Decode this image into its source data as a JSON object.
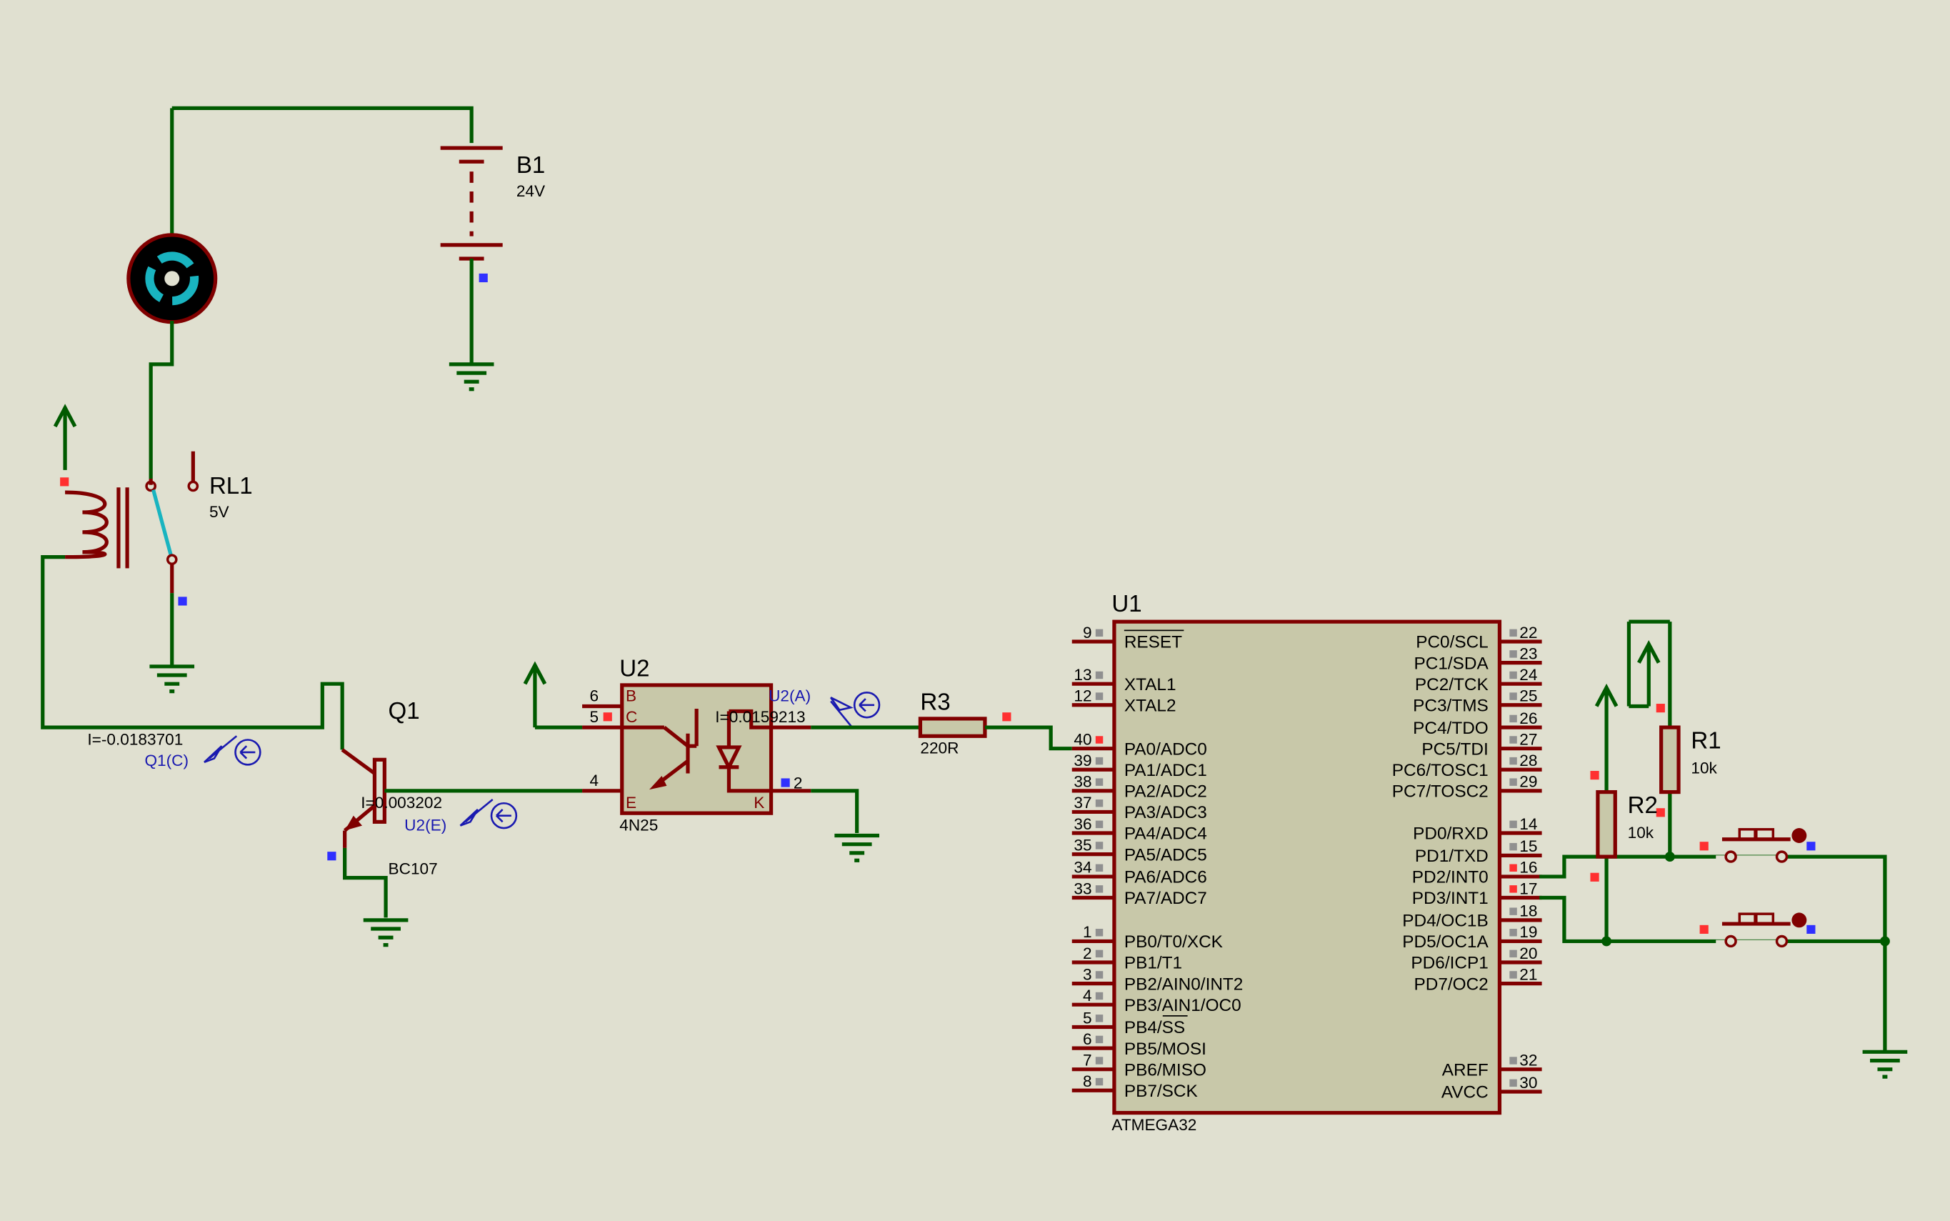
{
  "colors": {
    "background": "#e0e0d0",
    "wire": "#005a00",
    "component": "#800000",
    "chip_fill": "#c8c8a9",
    "probe": "#1a1ab0",
    "pin_red": "#ff3030",
    "pin_blue": "#3030ff",
    "pin_grey": "#909090",
    "motor_accent": "#19b4c0"
  },
  "battery": {
    "ref": "B1",
    "value": "24V"
  },
  "relay": {
    "ref": "RL1",
    "value": "5V"
  },
  "transistor": {
    "ref": "Q1",
    "part": "BC107"
  },
  "optocoupler": {
    "ref": "U2",
    "part": "4N25",
    "pins": {
      "b_num": "6",
      "b_name": "B",
      "c_num": "5",
      "c_name": "C",
      "e_num": "4",
      "e_name": "E",
      "k_num": "2",
      "k_name": "K"
    }
  },
  "resistors": {
    "r3": {
      "ref": "R3",
      "value": "220R"
    },
    "r1": {
      "ref": "R1",
      "value": "10k"
    },
    "r2": {
      "ref": "R2",
      "value": "10k"
    }
  },
  "probes": {
    "q1c": {
      "reading": "I=-0.0183701",
      "name": "Q1(C)"
    },
    "u2e": {
      "reading": "I=0.003202",
      "name": "U2(E)"
    },
    "u2a": {
      "reading": "I=0.0159213",
      "name": "U2(A)"
    }
  },
  "mcu": {
    "ref": "U1",
    "part": "ATMEGA32",
    "left_pins": [
      {
        "num": "9",
        "name": "RESET"
      },
      {
        "num": "13",
        "name": "XTAL1"
      },
      {
        "num": "12",
        "name": "XTAL2"
      },
      {
        "num": "40",
        "name": "PA0/ADC0"
      },
      {
        "num": "39",
        "name": "PA1/ADC1"
      },
      {
        "num": "38",
        "name": "PA2/ADC2"
      },
      {
        "num": "37",
        "name": "PA3/ADC3"
      },
      {
        "num": "36",
        "name": "PA4/ADC4"
      },
      {
        "num": "35",
        "name": "PA5/ADC5"
      },
      {
        "num": "34",
        "name": "PA6/ADC6"
      },
      {
        "num": "33",
        "name": "PA7/ADC7"
      },
      {
        "num": "1",
        "name": "PB0/T0/XCK"
      },
      {
        "num": "2",
        "name": "PB1/T1"
      },
      {
        "num": "3",
        "name": "PB2/AIN0/INT2"
      },
      {
        "num": "4",
        "name": "PB3/AIN1/OC0"
      },
      {
        "num": "5",
        "name": "PB4/SS"
      },
      {
        "num": "6",
        "name": "PB5/MOSI"
      },
      {
        "num": "7",
        "name": "PB6/MISO"
      },
      {
        "num": "8",
        "name": "PB7/SCK"
      }
    ],
    "right_pins": [
      {
        "num": "22",
        "name": "PC0/SCL"
      },
      {
        "num": "23",
        "name": "PC1/SDA"
      },
      {
        "num": "24",
        "name": "PC2/TCK"
      },
      {
        "num": "25",
        "name": "PC3/TMS"
      },
      {
        "num": "26",
        "name": "PC4/TDO"
      },
      {
        "num": "27",
        "name": "PC5/TDI"
      },
      {
        "num": "28",
        "name": "PC6/TOSC1"
      },
      {
        "num": "29",
        "name": "PC7/TOSC2"
      },
      {
        "num": "14",
        "name": "PD0/RXD"
      },
      {
        "num": "15",
        "name": "PD1/TXD"
      },
      {
        "num": "16",
        "name": "PD2/INT0"
      },
      {
        "num": "17",
        "name": "PD3/INT1"
      },
      {
        "num": "18",
        "name": "PD4/OC1B"
      },
      {
        "num": "19",
        "name": "PD5/OC1A"
      },
      {
        "num": "20",
        "name": "PD6/ICP1"
      },
      {
        "num": "21",
        "name": "PD7/OC2"
      },
      {
        "num": "32",
        "name": "AREF"
      },
      {
        "num": "30",
        "name": "AVCC"
      }
    ]
  }
}
